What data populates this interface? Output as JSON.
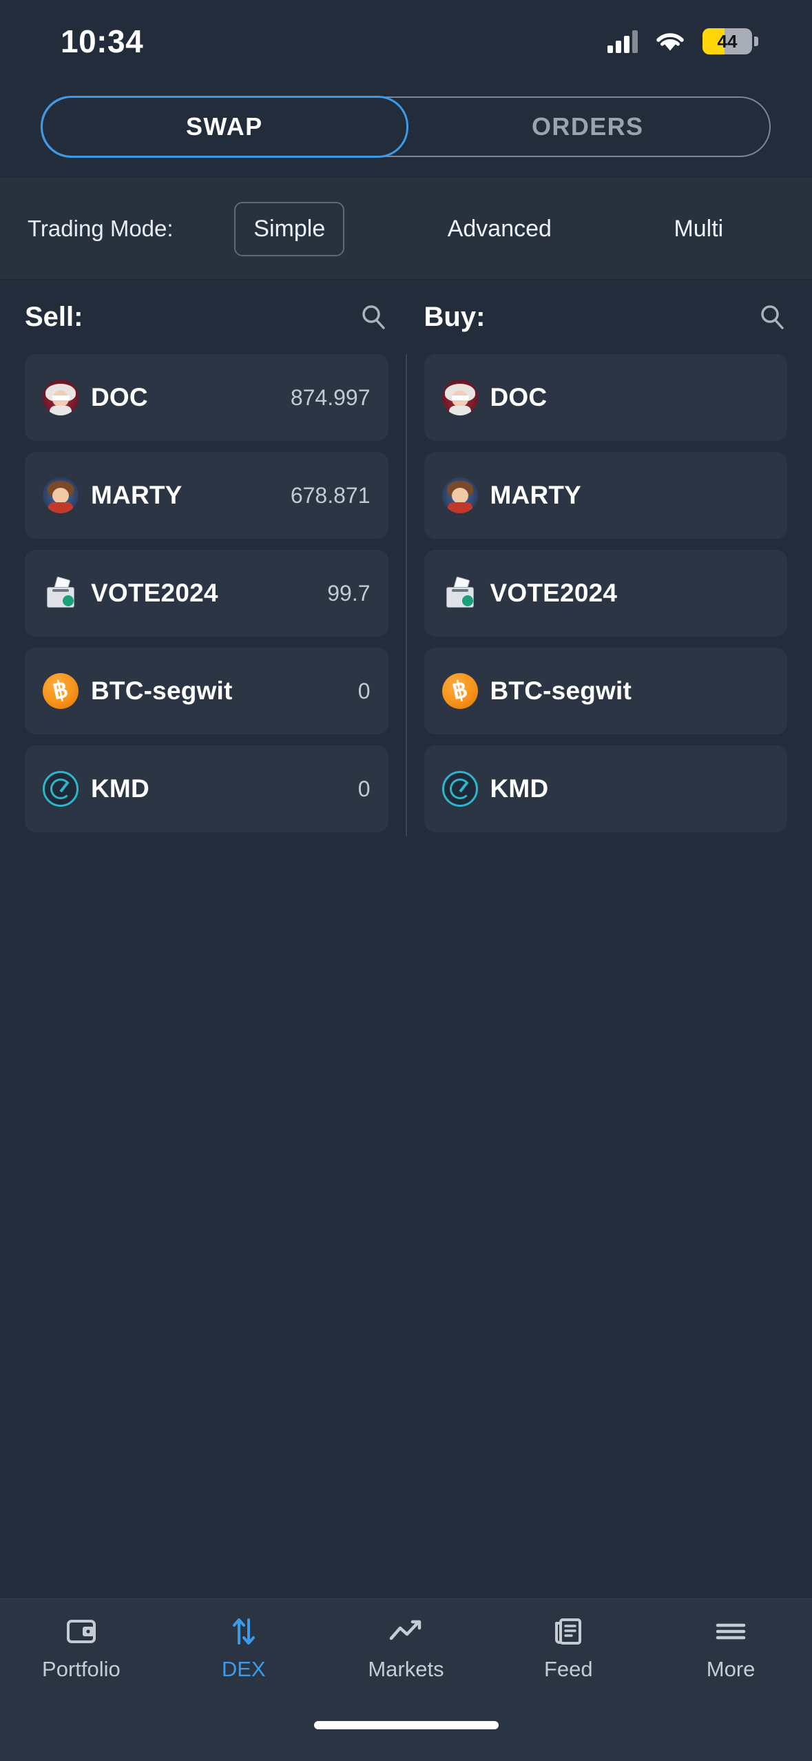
{
  "status_bar": {
    "time": "10:34",
    "battery_percent": "44",
    "signal_icon": "cellular-signal-icon",
    "wifi_icon": "wifi-icon",
    "battery_icon": "battery-icon"
  },
  "top_tabs": {
    "items": [
      {
        "label": "SWAP",
        "active": true
      },
      {
        "label": "ORDERS",
        "active": false
      }
    ],
    "active_color": "#3d9ae8"
  },
  "trading_mode": {
    "label": "Trading Mode:",
    "options": [
      {
        "label": "Simple",
        "selected": true
      },
      {
        "label": "Advanced",
        "selected": false
      },
      {
        "label": "Multi",
        "selected": false
      }
    ]
  },
  "sell": {
    "title": "Sell:",
    "search_icon": "search-icon",
    "coins": [
      {
        "name": "DOC",
        "balance": "874.997",
        "icon": "doc-coin-icon"
      },
      {
        "name": "MARTY",
        "balance": "678.871",
        "icon": "marty-coin-icon"
      },
      {
        "name": "VOTE2024",
        "balance": "99.7",
        "icon": "vote2024-coin-icon"
      },
      {
        "name": "BTC-segwit",
        "balance": "0",
        "icon": "btc-coin-icon"
      },
      {
        "name": "KMD",
        "balance": "0",
        "icon": "kmd-coin-icon"
      }
    ]
  },
  "buy": {
    "title": "Buy:",
    "search_icon": "search-icon",
    "coins": [
      {
        "name": "DOC",
        "balance": "",
        "icon": "doc-coin-icon"
      },
      {
        "name": "MARTY",
        "balance": "",
        "icon": "marty-coin-icon"
      },
      {
        "name": "VOTE2024",
        "balance": "",
        "icon": "vote2024-coin-icon"
      },
      {
        "name": "BTC-segwit",
        "balance": "",
        "icon": "btc-coin-icon"
      },
      {
        "name": "KMD",
        "balance": "",
        "icon": "kmd-coin-icon"
      }
    ]
  },
  "bottom_nav": {
    "items": [
      {
        "label": "Portfolio",
        "icon": "wallet-icon",
        "active": false
      },
      {
        "label": "DEX",
        "icon": "swap-arrows-icon",
        "active": true
      },
      {
        "label": "Markets",
        "icon": "chart-line-icon",
        "active": false
      },
      {
        "label": "Feed",
        "icon": "news-icon",
        "active": false
      },
      {
        "label": "More",
        "icon": "hamburger-menu-icon",
        "active": false
      }
    ],
    "active_color": "#3d9ae8"
  }
}
